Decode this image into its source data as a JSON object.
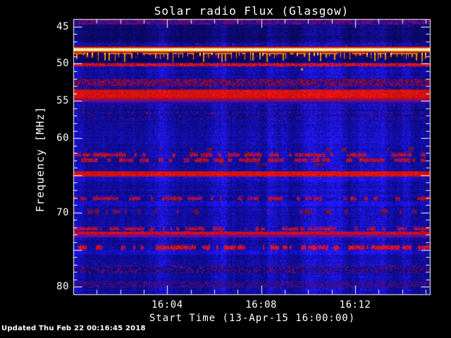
{
  "title": "Solar radio Flux (Glasgow)",
  "footer": "Updated Thu Feb 22 00:16:45 2018",
  "colors": {
    "background": "#000000",
    "frame": "#ffffff",
    "text": "#ffffff",
    "base_blue": "#1414c8",
    "dark_navy": "#05054a",
    "bright_red": "#e60800",
    "maroon": "#7c0820",
    "purple": "#6a14a0",
    "orange": "#ff9010",
    "yellow": "#ffd860",
    "cream": "#fffad0"
  },
  "chart_data": {
    "type": "heatmap",
    "title": "Solar radio Flux (Glasgow)",
    "xlabel": "Start Time (13-Apr-15 16:00:00)",
    "ylabel": "Frequency [MHz]",
    "legend": "none",
    "grid": false,
    "x_axis": {
      "start_label": "16:00:00",
      "minutes_span": 15.18,
      "major_ticks": [
        {
          "label": "16:04",
          "minute": 4
        },
        {
          "label": "16:08",
          "minute": 8
        },
        {
          "label": "16:12",
          "minute": 12
        }
      ],
      "minor_tick_every_minutes": 1
    },
    "y_axis": {
      "unit": "MHz",
      "top_value": 44,
      "bottom_value": 81,
      "major_ticks": [
        45,
        50,
        55,
        60,
        70,
        80
      ],
      "medium_ticks": [
        65,
        75
      ],
      "minor_tick_every_mhz": 1
    },
    "features": [
      {
        "style": "purple_mottle",
        "f1": 44.05,
        "f2": 44.78
      },
      {
        "style": "blue_dark",
        "f1": 44.78,
        "f2": 47.1
      },
      {
        "style": "blue_speckle",
        "f1": 47.1,
        "f2": 47.72,
        "speckle": 0.05
      },
      {
        "style": "bright_line",
        "f1": 47.72,
        "f2": 48.55
      },
      {
        "style": "spike_row",
        "f1": 48.55,
        "f2": 49.9
      },
      {
        "style": "dash_row",
        "f1": 49.9,
        "f2": 50.42,
        "density": 0.85,
        "intensity": 0.95,
        "purple_mix": 0.1
      },
      {
        "style": "blue",
        "f1": 50.42,
        "f2": 52.05
      },
      {
        "style": "maroon_mottle",
        "f1": 52.05,
        "f2": 53.0
      },
      {
        "style": "blue_purple",
        "f1": 53.0,
        "f2": 53.5
      },
      {
        "style": "red_solid",
        "f1": 53.5,
        "f2": 54.7
      },
      {
        "style": "purple_fade",
        "f1": 54.7,
        "f2": 55.4
      },
      {
        "style": "blue_speckle",
        "f1": 55.4,
        "f2": 57.9,
        "speckle": 0.06
      },
      {
        "style": "blue",
        "f1": 57.9,
        "f2": 61.1
      },
      {
        "style": "dash_row",
        "f1": 61.1,
        "f2": 61.9,
        "density": 0.22,
        "intensity": 0.5,
        "purple_mix": 0.2
      },
      {
        "style": "dash_row",
        "f1": 61.9,
        "f2": 62.6,
        "density": 0.5,
        "intensity": 0.85,
        "purple_mix": 0.25
      },
      {
        "style": "dash_row",
        "f1": 62.6,
        "f2": 63.3,
        "density": 0.5,
        "intensity": 0.8,
        "purple_mix": 0.25
      },
      {
        "style": "dash_row",
        "f1": 63.3,
        "f2": 63.8,
        "density": 0.18,
        "intensity": 0.4,
        "purple_mix": 0.2
      },
      {
        "style": "blue",
        "f1": 63.8,
        "f2": 64.45
      },
      {
        "style": "red_solid",
        "f1": 64.45,
        "f2": 65.2
      },
      {
        "style": "blue_bright",
        "f1": 65.2,
        "f2": 65.8
      },
      {
        "style": "blue",
        "f1": 65.8,
        "f2": 67.75
      },
      {
        "style": "dash_row",
        "f1": 67.75,
        "f2": 68.55,
        "density": 0.5,
        "intensity": 0.8,
        "purple_mix": 0.35
      },
      {
        "style": "blue_bright",
        "f1": 68.55,
        "f2": 69.2
      },
      {
        "style": "dash_row",
        "f1": 69.5,
        "f2": 70.3,
        "density": 0.3,
        "intensity": 0.5,
        "purple_mix": 0.3
      },
      {
        "style": "blue",
        "f1": 70.3,
        "f2": 71.85
      },
      {
        "style": "dash_row",
        "f1": 71.85,
        "f2": 72.6,
        "density": 0.55,
        "intensity": 0.85,
        "purple_mix": 0.3
      },
      {
        "style": "red_purple_line",
        "f1": 72.6,
        "f2": 73.3
      },
      {
        "style": "blue",
        "f1": 73.3,
        "f2": 74.25
      },
      {
        "style": "dash_row",
        "f1": 74.25,
        "f2": 75.1,
        "density": 0.6,
        "intensity": 1.0,
        "purple_mix": 0.2
      },
      {
        "style": "blue_bright",
        "f1": 75.1,
        "f2": 75.7
      },
      {
        "style": "blue",
        "f1": 75.7,
        "f2": 77.1
      },
      {
        "style": "purple_speckle",
        "f1": 77.1,
        "f2": 78.2
      },
      {
        "style": "blue",
        "f1": 78.2,
        "f2": 79.3
      },
      {
        "style": "purple_band",
        "f1": 79.3,
        "f2": 80.1
      },
      {
        "style": "blue",
        "f1": 80.1,
        "f2": 81.0
      }
    ],
    "point_features": [
      {
        "style": "orange_dot",
        "minute": 9.72,
        "f": 50.72
      }
    ]
  }
}
